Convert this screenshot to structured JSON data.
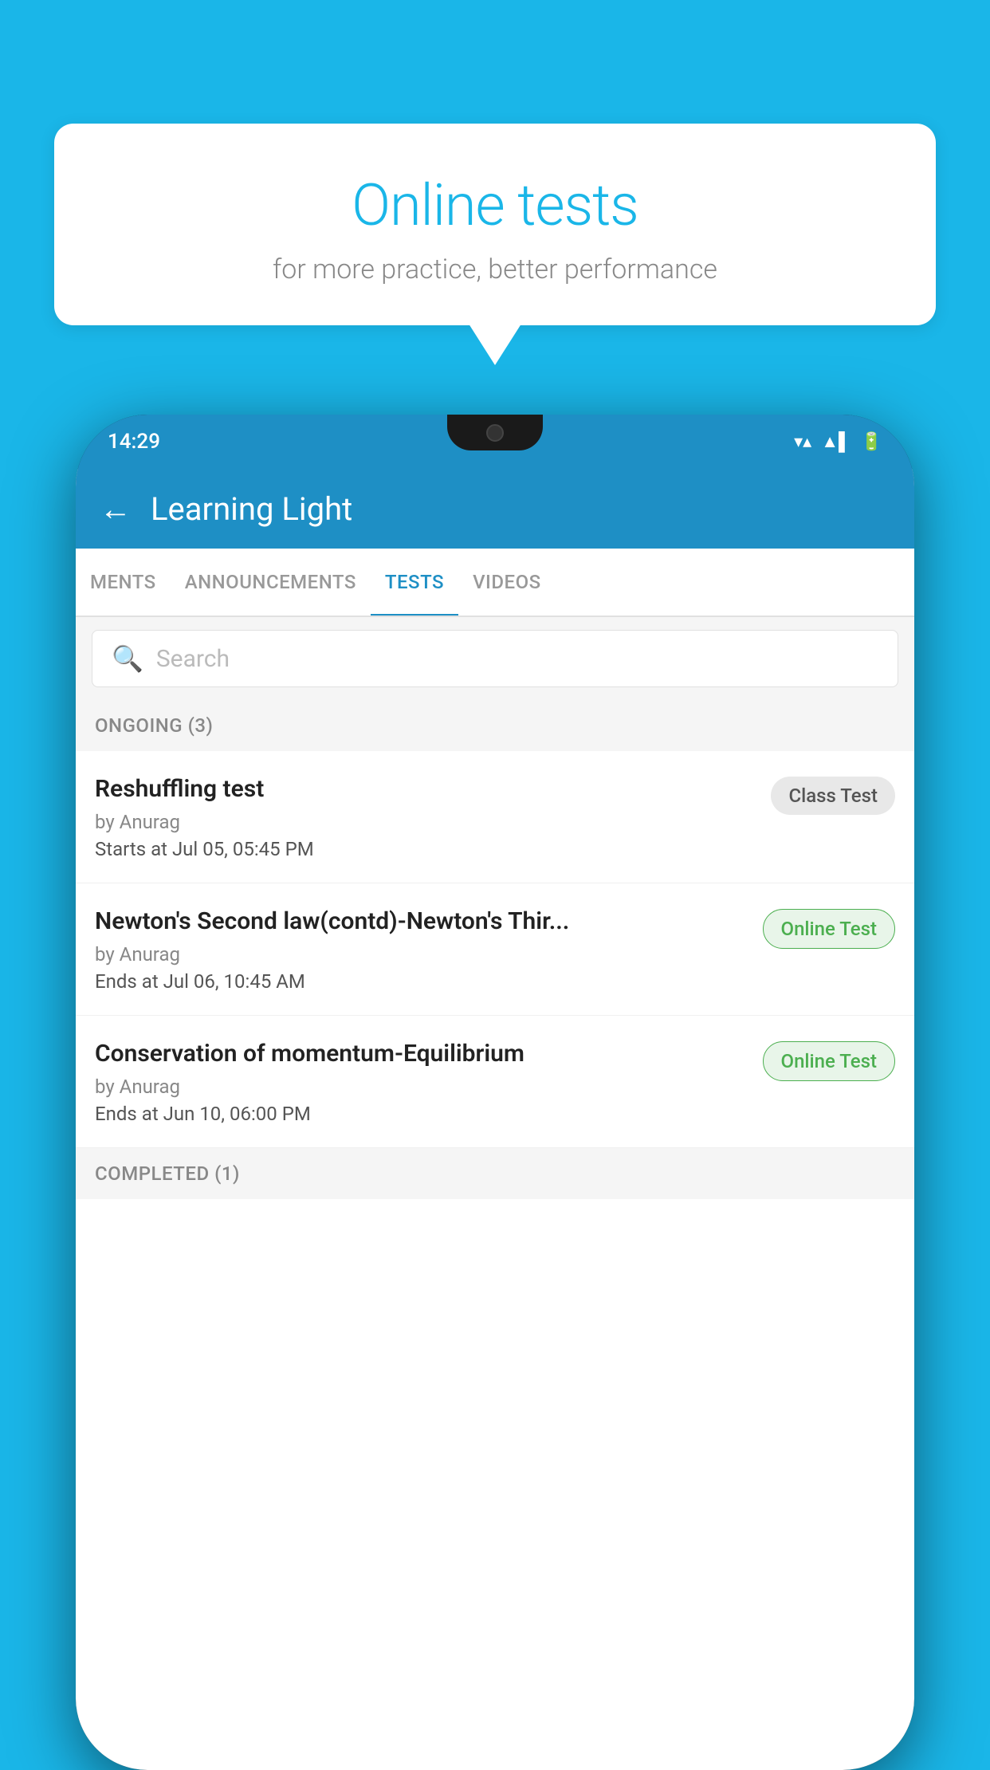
{
  "background": {
    "color": "#1ab6e8"
  },
  "speech_bubble": {
    "title": "Online tests",
    "subtitle": "for more practice, better performance"
  },
  "status_bar": {
    "time": "14:29",
    "signal_icon": "▼",
    "wifi_icon": "▲",
    "battery_icon": "▌"
  },
  "app_bar": {
    "back_label": "←",
    "title": "Learning Light"
  },
  "tabs": [
    {
      "label": "MENTS",
      "active": false
    },
    {
      "label": "ANNOUNCEMENTS",
      "active": false
    },
    {
      "label": "TESTS",
      "active": true
    },
    {
      "label": "VIDEOS",
      "active": false
    }
  ],
  "search": {
    "placeholder": "Search"
  },
  "sections": [
    {
      "label": "ONGOING (3)",
      "tests": [
        {
          "name": "Reshuffling test",
          "author": "by Anurag",
          "time_label": "Starts at",
          "time_value": "Jul 05, 05:45 PM",
          "badge": "Class Test",
          "badge_type": "class"
        },
        {
          "name": "Newton's Second law(contd)-Newton's Thir...",
          "author": "by Anurag",
          "time_label": "Ends at",
          "time_value": "Jul 06, 10:45 AM",
          "badge": "Online Test",
          "badge_type": "online"
        },
        {
          "name": "Conservation of momentum-Equilibrium",
          "author": "by Anurag",
          "time_label": "Ends at",
          "time_value": "Jun 10, 06:00 PM",
          "badge": "Online Test",
          "badge_type": "online"
        }
      ]
    }
  ],
  "completed_label": "COMPLETED (1)"
}
